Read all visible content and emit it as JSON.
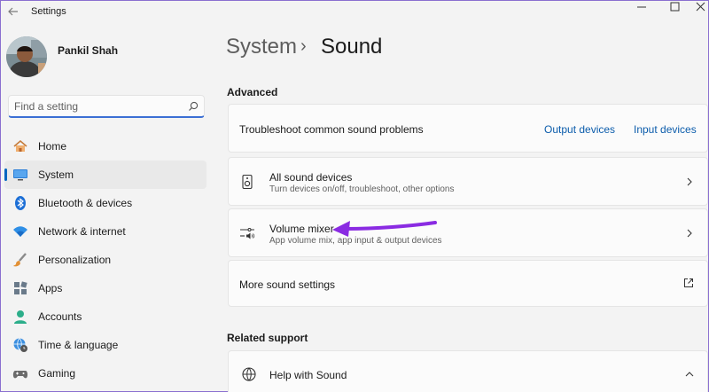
{
  "window": {
    "title": "Settings"
  },
  "user": {
    "name": "Pankil Shah"
  },
  "search": {
    "placeholder": "Find a setting"
  },
  "nav": {
    "items": [
      {
        "label": "Home",
        "icon": "home-icon"
      },
      {
        "label": "System",
        "icon": "monitor-icon",
        "active": true
      },
      {
        "label": "Bluetooth & devices",
        "icon": "bluetooth-icon"
      },
      {
        "label": "Network & internet",
        "icon": "wifi-icon"
      },
      {
        "label": "Personalization",
        "icon": "brush-icon"
      },
      {
        "label": "Apps",
        "icon": "apps-icon"
      },
      {
        "label": "Accounts",
        "icon": "person-icon"
      },
      {
        "label": "Time & language",
        "icon": "globe-clock-icon"
      },
      {
        "label": "Gaming",
        "icon": "gamepad-icon"
      }
    ]
  },
  "breadcrumb": {
    "parent": "System",
    "separator": "›",
    "current": "Sound"
  },
  "advanced": {
    "heading": "Advanced",
    "troubleshoot": {
      "label": "Troubleshoot common sound problems",
      "output_link": "Output devices",
      "input_link": "Input devices"
    },
    "all_devices": {
      "title": "All sound devices",
      "subtitle": "Turn devices on/off, troubleshoot, other options"
    },
    "volume_mixer": {
      "title": "Volume mixer",
      "subtitle": "App volume mix, app input & output devices"
    },
    "more_settings": {
      "title": "More sound settings"
    }
  },
  "related": {
    "heading": "Related support",
    "help": {
      "title": "Help with Sound"
    }
  },
  "colors": {
    "accent": "#0067c0",
    "link": "#0b5cab",
    "annotation_arrow": "#8a2be2"
  }
}
